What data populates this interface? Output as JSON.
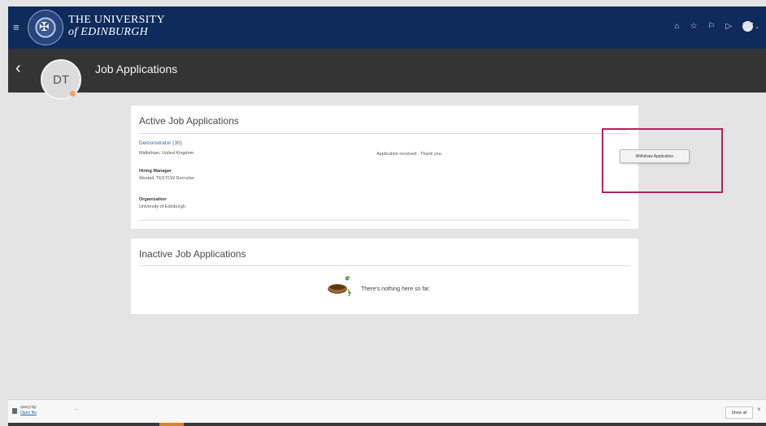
{
  "header": {
    "university_line1": "THE UNIVERSITY",
    "university_line2": "of EDINBURGH",
    "icons": [
      "menu-icon",
      "home-icon",
      "star-icon",
      "flag-icon",
      "notifications-icon"
    ],
    "user_initials": "DT",
    "colors": {
      "university_bar": "#0e2b5c",
      "title_bar": "#343434"
    }
  },
  "titlebar": {
    "title": "Job Applications",
    "avatar_initials": "DT"
  },
  "active": {
    "heading": "Active Job Applications",
    "job_title": "Demonstrator (30)",
    "location": "Midlothian, United Kingdom",
    "status": "Application received - Thank you",
    "hiring_manager_label": "Hiring Manager",
    "hiring_manager_value": "Westall, TESTCW Recruiter",
    "organization_label": "Organization",
    "organization_value": "University of Edinburgh",
    "more_label": "...",
    "withdraw_label": "Withdraw Application",
    "highlight_color": "#b0245a"
  },
  "inactive": {
    "heading": "Inactive Job Applications",
    "empty_message": "There's nothing here so far."
  },
  "downloads": {
    "file_name": "query.lqy",
    "open_label": "Open file",
    "more_label": "...",
    "show_all_label": "Show all",
    "close_label": "×"
  }
}
